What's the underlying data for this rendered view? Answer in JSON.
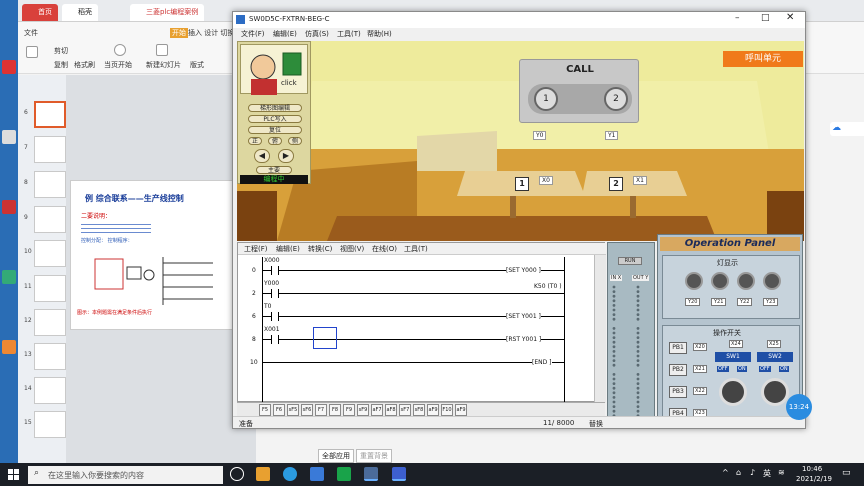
{
  "wps": {
    "tabs": [
      {
        "label": "首页"
      },
      {
        "label": "稻壳"
      },
      {
        "label": "三菱plc编程案例"
      }
    ],
    "ribbon": {
      "file": "文件",
      "start": "开始",
      "insert_tab": "插入 设计 切换",
      "cut": "剪切",
      "copy": "复制",
      "format_painter": "格式刷",
      "paste": "粘贴",
      "from_current": "当页开始",
      "new_slide": "新建幻灯片",
      "layout": "版式"
    },
    "slide_numbers": [
      "6",
      "7",
      "8",
      "9",
      "10",
      "11",
      "12",
      "13",
      "14",
      "15"
    ],
    "slide": {
      "title": "例  综合联系——生产线控制",
      "red_label": "二要说明：",
      "body": "控制分配： 控制程序：",
      "bottom_note": "图示：本例题需在满足条件后执行"
    },
    "bottom": {
      "apply_all": "全部应用",
      "reset_bg": "重置背景"
    }
  },
  "sim": {
    "title": "SW0D5C-FXTRN-BEG-C",
    "menu": [
      "文件(F)",
      "编辑(E)",
      "仿真(S)",
      "工具(T)",
      "帮助(H)"
    ],
    "call_button": "呼叫单元",
    "call_label": "CALL",
    "btn1": "1",
    "btn2": "2",
    "y0": "Y0",
    "y1": "Y1",
    "x0": "X0",
    "x1": "X1",
    "table1": "1",
    "table2": "2",
    "control_panel": {
      "click": "click",
      "ladder_edit": "梯形图编辑",
      "plc_write": "PLC写入",
      "reset": "复位",
      "front": "正",
      "side": "俯",
      "side2": "侧",
      "main": "主要",
      "status": "编程中"
    },
    "ladder": {
      "menu": [
        "工程(F)",
        "编辑(E)",
        "转换(C)",
        "视图(V)",
        "在线(O)",
        "工具(T)"
      ],
      "rungs": [
        {
          "step": "0",
          "contact": "X000",
          "coil": "[SET   Y000 ]"
        },
        {
          "step": "2",
          "contact": "Y000",
          "coil": "K50  (T0 )"
        },
        {
          "step": "6",
          "contact": "T0",
          "coil": "[SET   Y001 ]"
        },
        {
          "step": "8",
          "contact": "X001",
          "coil": "[RST   Y001 ]"
        },
        {
          "step": "10",
          "contact": "",
          "coil": "[END  ]"
        }
      ]
    },
    "io": {
      "run": "RUN",
      "in_label": "IN X",
      "out_label": "OUT Y"
    },
    "op_panel": {
      "title": "Operation Panel",
      "lamp_title": "灯显示",
      "lamps": [
        "Y20",
        "Y21",
        "Y22",
        "Y23"
      ],
      "switch_title": "操作开关",
      "pb": [
        "PB1",
        "PB2",
        "PB3",
        "PB4"
      ],
      "pb_x": [
        "X20",
        "X21",
        "X22",
        "X23"
      ],
      "sw_x": [
        "X24",
        "X25"
      ],
      "sw": [
        "SW1",
        "SW2"
      ],
      "off": "OFF",
      "on": "ON"
    },
    "fkeys": [
      "F5",
      "F6",
      "sF5",
      "sF6",
      "F7",
      "F8",
      "F9",
      "sF9",
      "aF7",
      "aF8",
      "sF7",
      "sF8",
      "aF9",
      "F10",
      "aF9"
    ],
    "status_left": "准备",
    "status_right": "11/ 8000",
    "status_mode": "替换",
    "time_badge": "13:24"
  },
  "taskbar": {
    "search_placeholder": "在这里输入你要搜索的内容",
    "ime": "英",
    "time": "10:46",
    "date": "2021/2/19"
  }
}
